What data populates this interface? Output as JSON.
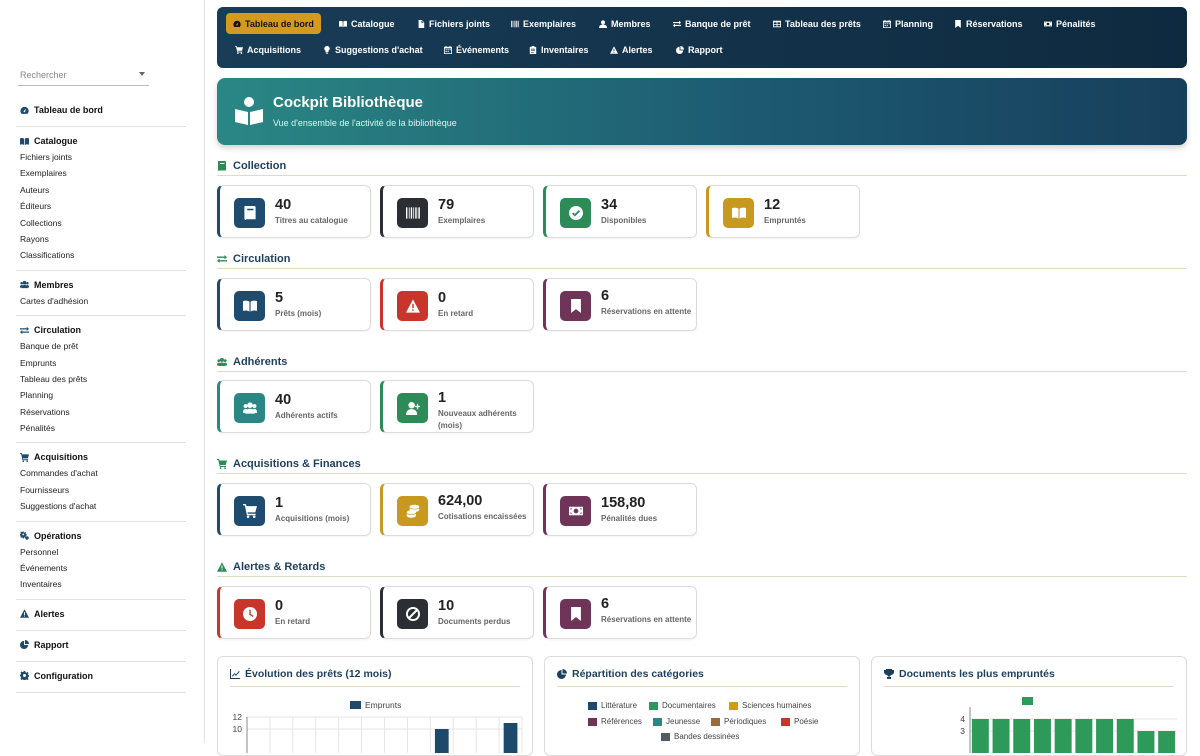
{
  "colors": {
    "navy": "#1f4b6e",
    "dark": "#2b2e33",
    "green": "#2c8b57",
    "gold": "#c79a1f",
    "red": "#c8362b",
    "purple": "#6e3558",
    "teal": "#2a8784",
    "bar_navy": "#1d4a6b",
    "bar_green": "#2e9a5a"
  },
  "search": {
    "placeholder": "Rechercher"
  },
  "sidebar": {
    "groups": [
      {
        "title": "Tableau de bord",
        "icon": "gauge-icon",
        "items": []
      },
      {
        "title": "Catalogue",
        "icon": "book-open-icon",
        "items": [
          "Fichiers joints",
          "Exemplaires",
          "Auteurs",
          "Éditeurs",
          "Collections",
          "Rayons",
          "Classifications"
        ]
      },
      {
        "title": "Membres",
        "icon": "users-icon",
        "items": [
          "Cartes d'adhésion"
        ]
      },
      {
        "title": "Circulation",
        "icon": "exchange-icon",
        "items": [
          "Banque de prêt",
          "Emprunts",
          "Tableau des prêts",
          "Planning",
          "Réservations",
          "Pénalités"
        ]
      },
      {
        "title": "Acquisitions",
        "icon": "cart-icon",
        "items": [
          "Commandes d'achat",
          "Fournisseurs",
          "Suggestions d'achat"
        ]
      },
      {
        "title": "Opérations",
        "icon": "cogs-icon",
        "items": [
          "Personnel",
          "Événements",
          "Inventaires"
        ]
      },
      {
        "title": "Alertes",
        "icon": "warning-icon",
        "items": []
      },
      {
        "title": "Rapport",
        "icon": "pie-icon",
        "items": []
      },
      {
        "title": "Configuration",
        "icon": "gear-icon",
        "items": []
      }
    ]
  },
  "topnav": {
    "row1": [
      {
        "label": "Tableau de bord",
        "icon": "gauge-icon",
        "active": true
      },
      {
        "label": "Catalogue",
        "icon": "book-open-icon"
      },
      {
        "label": "Fichiers joints",
        "icon": "file-icon"
      },
      {
        "label": "Exemplaires",
        "icon": "barcode-icon"
      },
      {
        "label": "Membres",
        "icon": "user-icon"
      },
      {
        "label": "Banque de prêt",
        "icon": "exchange-icon"
      },
      {
        "label": "Tableau des prêts",
        "icon": "table-icon"
      },
      {
        "label": "Planning",
        "icon": "calendar-icon"
      },
      {
        "label": "Réservations",
        "icon": "bookmark-icon"
      },
      {
        "label": "Pénalités",
        "icon": "money-icon"
      }
    ],
    "row2": [
      {
        "label": "Acquisitions",
        "icon": "cart-icon"
      },
      {
        "label": "Suggestions d'achat",
        "icon": "lightbulb-icon"
      },
      {
        "label": "Événements",
        "icon": "calendar-icon"
      },
      {
        "label": "Inventaires",
        "icon": "clipboard-icon"
      },
      {
        "label": "Alertes",
        "icon": "warning-icon"
      },
      {
        "label": "Rapport",
        "icon": "pie-icon"
      }
    ]
  },
  "hero": {
    "title": "Cockpit Bibliothèque",
    "subtitle": "Vue d'ensemble de l'activité de la bibliothèque"
  },
  "sections": {
    "collection": {
      "title": "Collection",
      "cards": [
        {
          "value": "40",
          "label": "Titres au catalogue",
          "color": "navy",
          "icon": "book-icon"
        },
        {
          "value": "79",
          "label": "Exemplaires",
          "color": "dark",
          "icon": "barcode-icon"
        },
        {
          "value": "34",
          "label": "Disponibles",
          "color": "green",
          "icon": "check-icon"
        },
        {
          "value": "12",
          "label": "Empruntés",
          "color": "gold",
          "icon": "book-open-icon"
        }
      ]
    },
    "circulation": {
      "title": "Circulation",
      "cards": [
        {
          "value": "5",
          "label": "Prêts (mois)",
          "color": "navy",
          "icon": "book-open-icon"
        },
        {
          "value": "0",
          "label": "En retard",
          "color": "red",
          "icon": "warning-icon"
        },
        {
          "value": "6",
          "label": "Réservations en attente",
          "color": "purple",
          "icon": "bookmark-icon"
        }
      ]
    },
    "adherents": {
      "title": "Adhérents",
      "cards": [
        {
          "value": "40",
          "label": "Adhérents actifs",
          "color": "teal",
          "icon": "users-icon"
        },
        {
          "value": "1",
          "label": "Nouveaux adhérents (mois)",
          "color": "green",
          "icon": "user-plus-icon"
        }
      ]
    },
    "acquisitions": {
      "title": "Acquisitions & Finances",
      "cards": [
        {
          "value": "1",
          "label": "Acquisitions (mois)",
          "color": "navy",
          "icon": "cart-icon"
        },
        {
          "value": "624,00",
          "label": "Cotisations encaissées",
          "color": "gold",
          "icon": "coins-icon"
        },
        {
          "value": "158,80",
          "label": "Pénalités dues",
          "color": "purple",
          "icon": "money-icon"
        }
      ]
    },
    "alertes": {
      "title": "Alertes & Retards",
      "cards": [
        {
          "value": "0",
          "label": "En retard",
          "color": "red",
          "icon": "clock-icon"
        },
        {
          "value": "10",
          "label": "Documents perdus",
          "color": "dark",
          "icon": "ban-icon"
        },
        {
          "value": "6",
          "label": "Réservations en attente",
          "color": "purple",
          "icon": "bookmark-icon"
        }
      ]
    }
  },
  "panels": {
    "loans": {
      "title": "Évolution des prêts (12 mois)",
      "legend": "Emprunts"
    },
    "categories": {
      "title": "Répartition des catégories",
      "legend": [
        "Littérature",
        "Documentaires",
        "Sciences humaines",
        "Références",
        "Jeunesse",
        "Périodiques",
        "Poésie",
        "Bandes dessinées"
      ],
      "legend_colors": [
        "#1d4a6b",
        "#2e9a5a",
        "#d49a1c",
        "#6e3558",
        "#2a8784",
        "#9a6a3c",
        "#c8362b",
        "#555a60"
      ]
    },
    "top": {
      "title": "Documents les plus empruntés"
    }
  },
  "chart_data": [
    {
      "type": "bar",
      "title": "Évolution des prêts (12 mois)",
      "series": [
        {
          "name": "Emprunts",
          "values": [
            0,
            0,
            0,
            0,
            0,
            0,
            0,
            0,
            10,
            0,
            0,
            11
          ]
        }
      ],
      "categories": [],
      "yticks": [
        12,
        10
      ],
      "ylim": [
        0,
        12
      ],
      "legend": "top"
    },
    {
      "type": "bar",
      "title": "Documents les plus empruntés",
      "values": [
        4,
        4,
        4,
        4,
        4,
        4,
        4,
        4,
        3,
        3
      ],
      "legend_marker": true,
      "yticks": [
        4,
        3
      ],
      "ylim": [
        0,
        5
      ]
    }
  ]
}
